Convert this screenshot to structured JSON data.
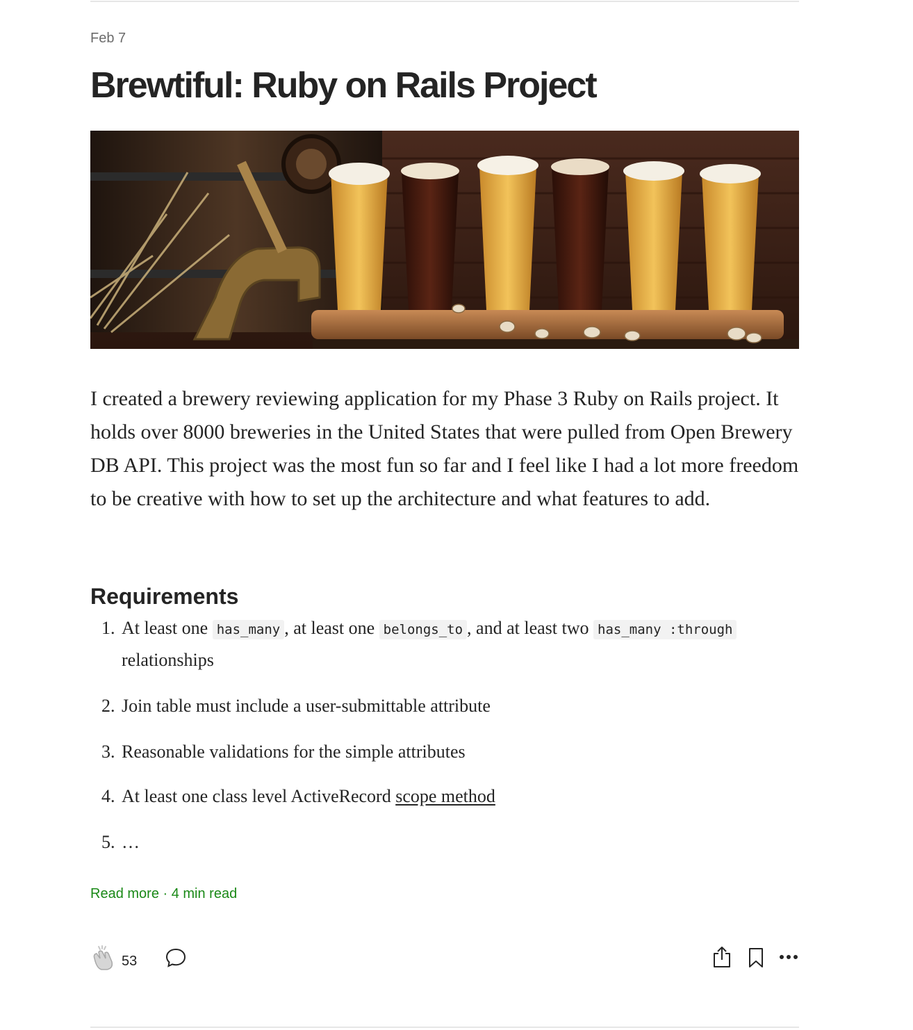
{
  "post": {
    "date": "Feb 7",
    "title": "Brewtiful: Ruby on Rails Project",
    "hero_image": "beer-flight-photo",
    "intro": "I created a brewery reviewing application for my Phase 3 Ruby on Rails project. It holds over 8000 breweries in the United States that were pulled from Open Brewery DB API. This project was the most fun so far and I feel like I had a lot more freedom to be creative with how to set up the architecture and what features to add.",
    "section_heading": "Requirements",
    "requirements": [
      {
        "number": "1.",
        "part1": "At least one ",
        "code1": "has_many",
        "part2": ", at least one ",
        "code2": "belongs_to",
        "part3": ", and at least two ",
        "code3": "has_many :through",
        "part4": "relationships"
      },
      {
        "number": "2.",
        "text": "Join table must include a user-submittable attribute"
      },
      {
        "number": "3.",
        "text": "Reasonable validations for the simple attributes"
      },
      {
        "number": "4.",
        "text": "At least one class level ActiveRecord ",
        "link": "scope method"
      },
      {
        "number": "5.",
        "text": "…"
      }
    ],
    "read_more": "Read more",
    "separator": " · ",
    "read_time": "4 min read"
  },
  "actions": {
    "clap_count": "53",
    "icons": [
      "clap-icon",
      "comment-icon",
      "share-icon",
      "bookmark-icon",
      "more-icon"
    ]
  },
  "colors": {
    "text": "#242424",
    "muted": "#6b6b6b",
    "accent_green": "#1a8917",
    "divider": "#e6e6e6"
  }
}
